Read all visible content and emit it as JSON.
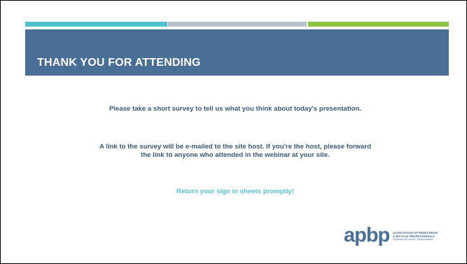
{
  "colors": {
    "stripe_teal": "#4fc1cf",
    "stripe_gray": "#b8c3cc",
    "stripe_green": "#8bc443",
    "title_bar": "#4a6f96",
    "body_text": "#3b5877",
    "highlight_text": "#56c2d1"
  },
  "slide": {
    "title": "THANK YOU FOR ATTENDING",
    "paragraphs": [
      "Please take a short survey to tell us what you think about today's presentation.",
      "A link to the survey will be e-mailed to the site host. If you're the host, please forward the link to anyone who attended in the webinar at your site.",
      "Return your sign in sheets promptly!"
    ]
  },
  "logo": {
    "wordmark": "apbp",
    "line1": "ASSOCIATION OF PEDESTRIAN",
    "line2": "& BICYCLE PROFESSIONALS",
    "tagline": "Expertise for Active Transportation"
  }
}
